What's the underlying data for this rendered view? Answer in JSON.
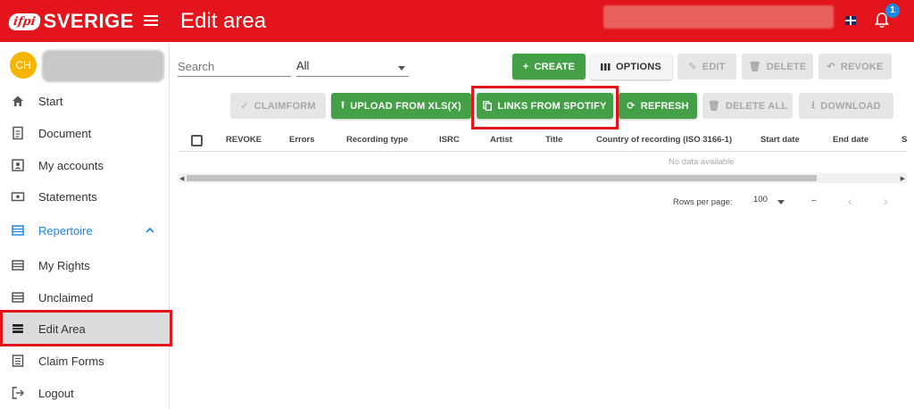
{
  "header": {
    "logo_ifpi": "ifpi",
    "logo_text": "SVERIGE",
    "title": "Edit area",
    "notification_count": "1",
    "brand_color": "#e3141b"
  },
  "sidebar": {
    "avatar_initials": "CH",
    "items": [
      {
        "label": "Start",
        "icon": "home-icon"
      },
      {
        "label": "Document",
        "icon": "document-icon"
      },
      {
        "label": "My accounts",
        "icon": "accounts-icon"
      },
      {
        "label": "Statements",
        "icon": "statements-icon"
      },
      {
        "label": "Repertoire",
        "icon": "list-icon",
        "expanded": true
      },
      {
        "label": "My Rights",
        "icon": "list-icon"
      },
      {
        "label": "Unclaimed",
        "icon": "list-icon"
      },
      {
        "label": "Edit Area",
        "icon": "list-icon",
        "selected": true
      },
      {
        "label": "Claim Forms",
        "icon": "form-icon"
      },
      {
        "label": "Logout",
        "icon": "logout-icon"
      }
    ]
  },
  "toolbar": {
    "search_placeholder": "Search",
    "filter_value": "All",
    "row1": {
      "create": "CREATE",
      "options": "OPTIONS",
      "edit": "EDIT",
      "delete": "DELETE",
      "revoke": "REVOKE"
    },
    "row2": {
      "claimform": "CLAIMFORM",
      "upload": "UPLOAD FROM XLS(X)",
      "links": "LINKS FROM SPOTIFY",
      "refresh": "REFRESH",
      "delete_all": "DELETE ALL",
      "download": "DOWNLOAD"
    }
  },
  "table": {
    "columns": [
      "REVOKE",
      "Errors",
      "Recording type",
      "ISRC",
      "Artist",
      "Title",
      "Country of recording (ISO 3166-1)",
      "Start date",
      "End date",
      "S"
    ],
    "empty_text": "No data available"
  },
  "pagination": {
    "rows_per_page_label": "Rows per page:",
    "rows_per_page": "100",
    "range": "–"
  }
}
